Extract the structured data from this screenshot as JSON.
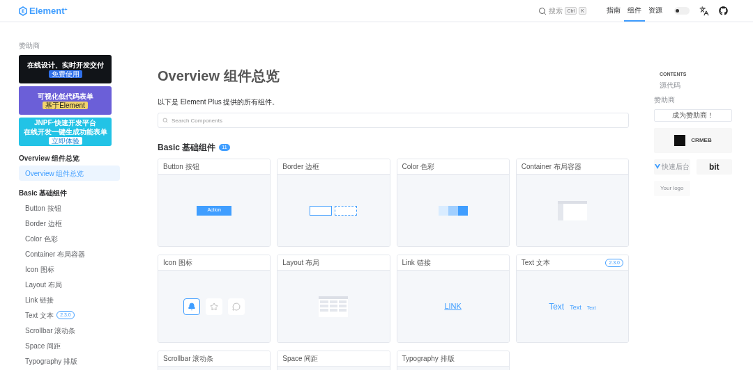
{
  "header": {
    "logo": "Element",
    "logo_sup": "+",
    "search": {
      "label": "搜索",
      "keys": [
        "Ctrl",
        "K"
      ]
    },
    "nav": [
      {
        "label": "指南",
        "selected": false
      },
      {
        "label": "组件",
        "selected": true
      },
      {
        "label": "资源",
        "selected": false
      }
    ],
    "theme_toggle": {
      "on": false
    }
  },
  "sidebar": {
    "sponsor_heading": "赞助商",
    "banners": [
      {
        "kind": "dark",
        "title": "在线设计、实时开发交付",
        "button": "免费使用"
      },
      {
        "kind": "purple",
        "title": "可视化低代码表单",
        "button": "基于Element"
      },
      {
        "kind": "cyan",
        "title": "JNPF·快速开发平台",
        "subtitle": "在线开发一键生成功能表单",
        "button": "立即体验"
      }
    ],
    "groups": [
      {
        "title": "Overview 组件总览",
        "items": [
          {
            "label": "Overview 组件总览",
            "selected": true
          }
        ]
      },
      {
        "title": "Basic 基础组件",
        "items": [
          {
            "label": "Button 按钮",
            "selected": false
          },
          {
            "label": "Border 边框",
            "selected": false
          },
          {
            "label": "Color 色彩",
            "selected": false
          },
          {
            "label": "Container 布局容器",
            "selected": false
          },
          {
            "label": "Icon 图标",
            "selected": false
          },
          {
            "label": "Layout 布局",
            "selected": false
          },
          {
            "label": "Link 链接",
            "selected": false
          },
          {
            "label": "Text 文本",
            "badge": "2.3.0",
            "selected": false
          },
          {
            "label": "Scrollbar 滚动条",
            "selected": false
          },
          {
            "label": "Space 间距",
            "selected": false
          },
          {
            "label": "Typography 排版",
            "selected": false
          }
        ]
      }
    ]
  },
  "main": {
    "title": "Overview 组件总览",
    "description": "以下是 Element Plus 提供的所有组件。",
    "search": {
      "placeholder": "Search Components"
    },
    "sections": [
      {
        "title": "Basic 基础组件",
        "count": "11",
        "cards": [
          {
            "title": "Button 按钮",
            "kind": "button",
            "preview_text": [
              "Action"
            ]
          },
          {
            "title": "Border 边框",
            "kind": "border"
          },
          {
            "title": "Color 色彩",
            "kind": "color"
          },
          {
            "title": "Container 布局容器",
            "kind": "container"
          },
          {
            "title": "Icon 图标",
            "kind": "icon"
          },
          {
            "title": "Layout 布局",
            "kind": "layout"
          },
          {
            "title": "Link 链接",
            "kind": "link",
            "preview_text": [
              "LINK"
            ]
          },
          {
            "title": "Text 文本",
            "kind": "text",
            "badge": "2.3.0",
            "preview_text": [
              "Text",
              "Text",
              "Text"
            ]
          },
          {
            "title": "Scrollbar 滚动条",
            "kind": "scrollbar"
          },
          {
            "title": "Space 间距",
            "kind": "space"
          },
          {
            "title": "Typography 排版",
            "kind": "typography"
          }
        ]
      }
    ]
  },
  "aside": {
    "contents_heading": "CONTENTS",
    "toc": [
      "源代码"
    ],
    "sponsor_heading": "赞助商",
    "become_sponsor": "成为赞助商！",
    "sponsors": [
      {
        "kind": "crmeb",
        "name": "CRMEB"
      },
      {
        "kind": "vue",
        "name": "快速后台"
      },
      {
        "kind": "bit",
        "name": "bit"
      },
      {
        "kind": "placeholder",
        "name": "Your logo"
      }
    ]
  }
}
